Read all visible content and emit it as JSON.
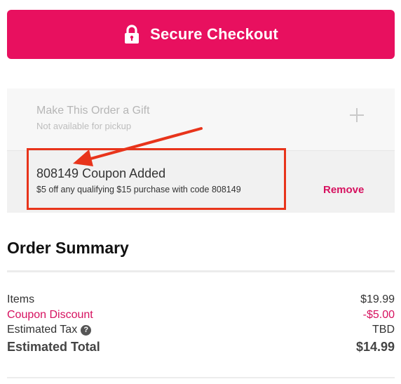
{
  "checkout": {
    "button_label": "Secure Checkout",
    "icon": "lock-icon",
    "color": "#e8105f"
  },
  "gift": {
    "title": "Make This Order a Gift",
    "subtitle": "Not available for pickup",
    "icon": "plus-icon"
  },
  "coupon": {
    "title": "808149 Coupon Added",
    "description": "$5 off any qualifying $15 purchase with code 808149",
    "remove_label": "Remove",
    "accent_color": "#d6115f"
  },
  "annotation": {
    "box_color": "#e8341b",
    "arrow_color": "#e8341b"
  },
  "summary": {
    "title": "Order Summary",
    "lines": [
      {
        "label": "Items",
        "value": "$19.99"
      },
      {
        "label": "Coupon Discount",
        "value": "-$5.00"
      },
      {
        "label": "Estimated Tax",
        "value": "TBD",
        "help_icon": "question-circle-icon",
        "help_glyph": "?"
      },
      {
        "label": "Estimated Total",
        "value": "$14.99"
      }
    ]
  }
}
